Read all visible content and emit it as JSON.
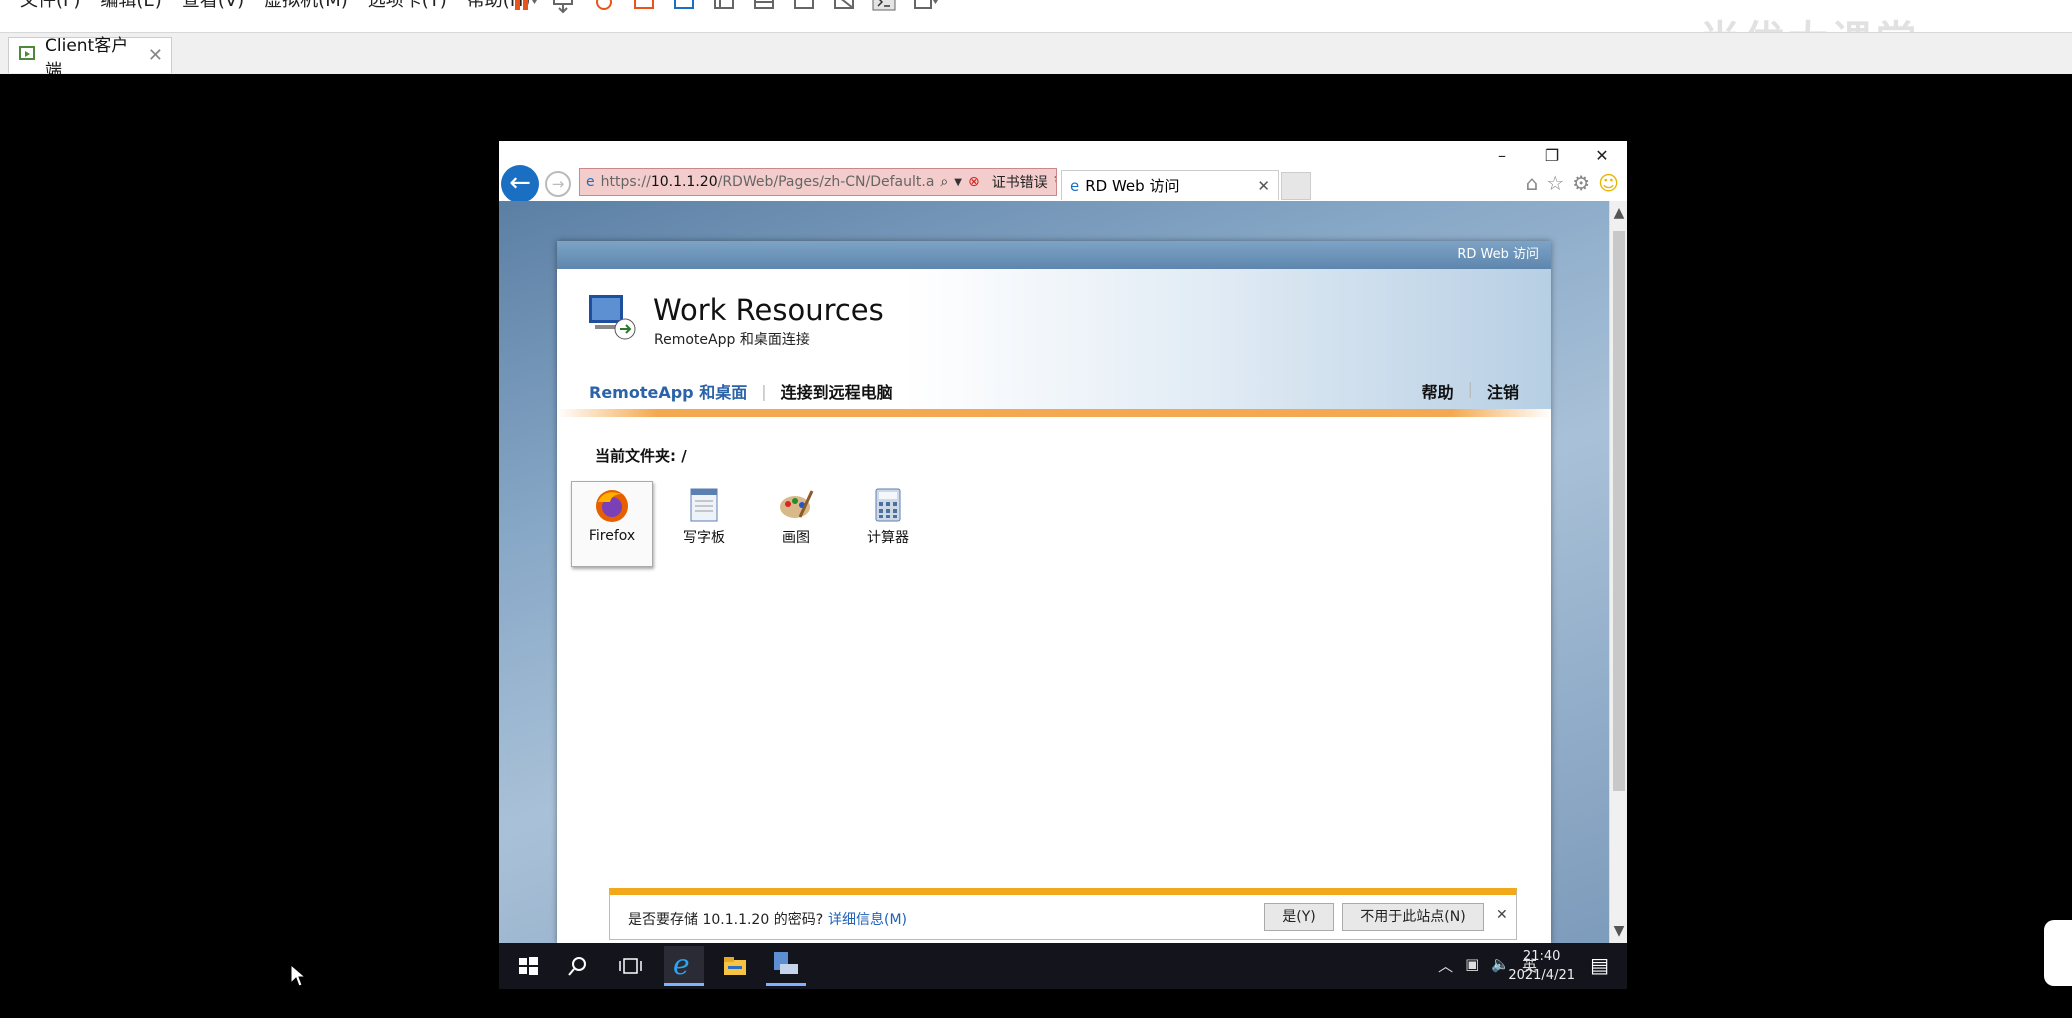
{
  "vm": {
    "menu": [
      "文件(F)",
      "编辑(E)",
      "查看(V)",
      "虚拟机(M)",
      "选项卡(T)",
      "帮助(H)"
    ],
    "tab_label": "Client客户端",
    "watermark": "尚优大课堂"
  },
  "ie": {
    "address_prefix": "https://",
    "address_host": "10.1.1.20",
    "address_path": "/RDWeb/Pages/zh-CN/Default.a",
    "cert_error": "证书错误",
    "tab_title": "RD Web 访问"
  },
  "rdweb": {
    "top_label": "RD Web 访问",
    "title": "Work Resources",
    "subtitle": "RemoteApp 和桌面连接",
    "nav": [
      "RemoteApp 和桌面",
      "连接到远程电脑"
    ],
    "nav_right": [
      "帮助",
      "注销"
    ],
    "current_folder": "当前文件夹: /",
    "apps": [
      "Firefox",
      "写字板",
      "画图",
      "计算器"
    ]
  },
  "notification": {
    "question": "是否要存储 10.1.1.20 的密码?",
    "details_link": "详细信息(M)",
    "yes": "是(Y)",
    "not_for_site": "不用于此站点(N)"
  },
  "taskbar": {
    "ime": "英",
    "time": "21:40",
    "date": "2021/4/21"
  },
  "colors": {
    "accent": "#1b6fc2",
    "notif_bar": "#f2a81b",
    "nav_active": "#2b62a8"
  }
}
